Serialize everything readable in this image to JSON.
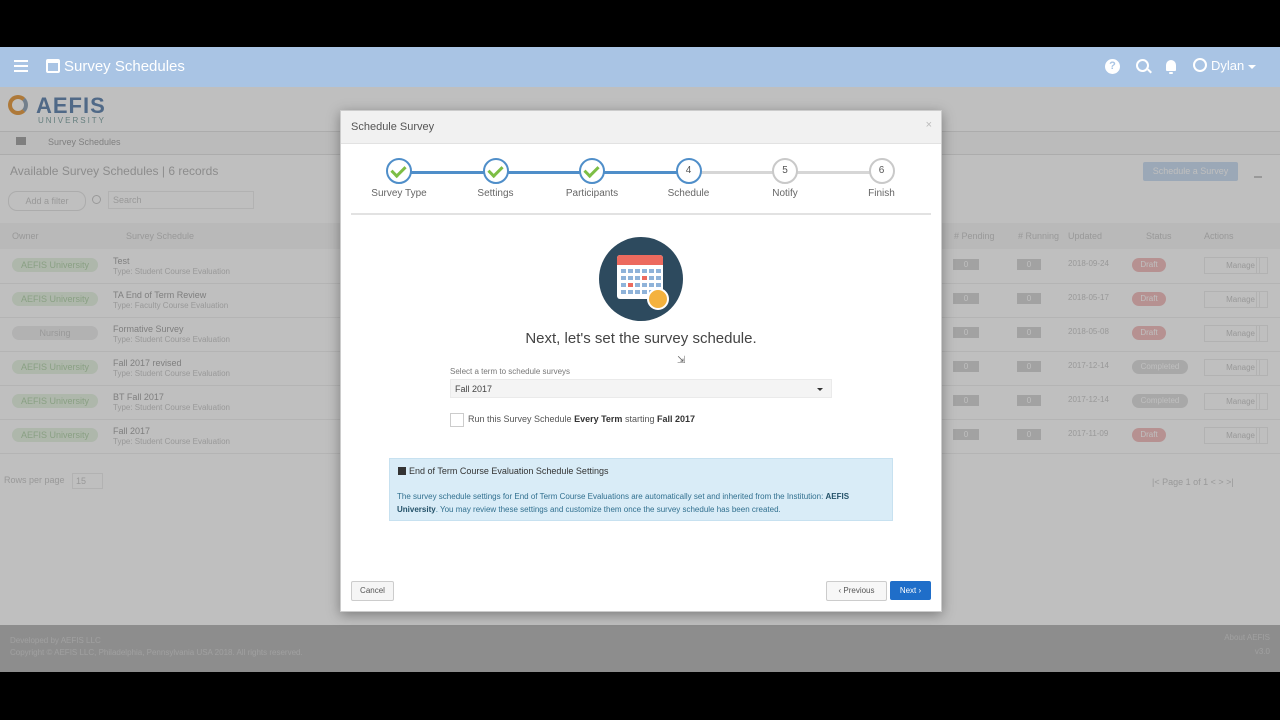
{
  "appbar": {
    "title": "Survey Schedules",
    "user": "Dylan",
    "help_symbol": "?"
  },
  "logo": {
    "name": "AEFIS",
    "sub": "UNIVERSITY"
  },
  "breadcrumb": {
    "item": "Survey Schedules"
  },
  "list": {
    "heading": "Available Survey Schedules | 6 records",
    "add_filter": "Add a filter",
    "search_placeholder": "Search",
    "schedule_button": "Schedule a Survey",
    "columns": [
      "Owner",
      "Survey Schedule",
      "# Pending",
      "# Running",
      "Updated",
      "Status",
      "Actions"
    ],
    "rows": [
      {
        "owner": "AEFIS University",
        "name": "Test",
        "type": "Type: Student Course Evaluation",
        "pending": "0",
        "running": "0",
        "updated": "2018-09-24",
        "status": "Draft",
        "action": "Manage"
      },
      {
        "owner": "AEFIS University",
        "name": "TA End of Term Review",
        "type": "Type: Faculty Course Evaluation",
        "pending": "0",
        "running": "0",
        "updated": "2018-05-17",
        "status": "Draft",
        "action": "Manage"
      },
      {
        "owner": "Nursing",
        "name": "Formative Survey",
        "type": "Type: Student Course Evaluation",
        "pending": "0",
        "running": "0",
        "updated": "2018-05-08",
        "status": "Draft",
        "action": "Manage"
      },
      {
        "owner": "AEFIS University",
        "name": "Fall 2017 revised",
        "type": "Type: Student Course Evaluation",
        "pending": "0",
        "running": "0",
        "updated": "2017-12-14",
        "status": "Completed",
        "action": "Manage"
      },
      {
        "owner": "AEFIS University",
        "name": "BT Fall 2017",
        "type": "Type: Student Course Evaluation",
        "pending": "0",
        "running": "0",
        "updated": "2017-12-14",
        "status": "Completed",
        "action": "Manage"
      },
      {
        "owner": "AEFIS University",
        "name": "Fall 2017",
        "type": "Type: Student Course Evaluation",
        "pending": "0",
        "running": "0",
        "updated": "2017-11-09",
        "status": "Draft",
        "action": "Manage"
      }
    ],
    "rows_per_page_label": "Rows per page",
    "rows_per_page_value": "15",
    "pager": "|< Page 1 of 1 < > >|"
  },
  "footer": {
    "developed_by": "Developed by AEFIS LLC",
    "copyright": "Copyright © AEFIS LLC, Philadelphia, Pennsylvania USA 2018. All rights reserved.",
    "about": "About AEFIS",
    "version": "v3.0"
  },
  "modal": {
    "title": "Schedule Survey",
    "close": "×",
    "steps": [
      {
        "label": "Survey Type",
        "number": "1",
        "state": "done"
      },
      {
        "label": "Settings",
        "number": "2",
        "state": "done"
      },
      {
        "label": "Participants",
        "number": "3",
        "state": "done"
      },
      {
        "label": "Schedule",
        "number": "4",
        "state": "active"
      },
      {
        "label": "Notify",
        "number": "5",
        "state": "todo"
      },
      {
        "label": "Finish",
        "number": "6",
        "state": "todo"
      }
    ],
    "lead": "Next, let's set the survey schedule.",
    "term_label": "Select a term to schedule surveys",
    "term_value": "Fall 2017",
    "repeat_prefix": "Run this Survey Schedule ",
    "repeat_bold1": "Every Term",
    "repeat_mid": " starting ",
    "repeat_bold2": "Fall 2017",
    "info_title": "End of Term Course Evaluation Schedule Settings",
    "info_body1": "The survey schedule settings for End of Term Course Evaluations are automatically set and inherited from the Institution: ",
    "info_body_bold": "AEFIS University",
    "info_body2": ". You may review these settings and customize them once the survey schedule has been created.",
    "cancel": "Cancel",
    "previous": "‹ Previous",
    "next": "Next ›"
  },
  "colors": {
    "appbar": "#a9c4e4",
    "step_active": "#4f8ec9",
    "check": "#7dbe45",
    "primary_button": "#1f6ec9",
    "info_bg": "#d9ecf7"
  }
}
